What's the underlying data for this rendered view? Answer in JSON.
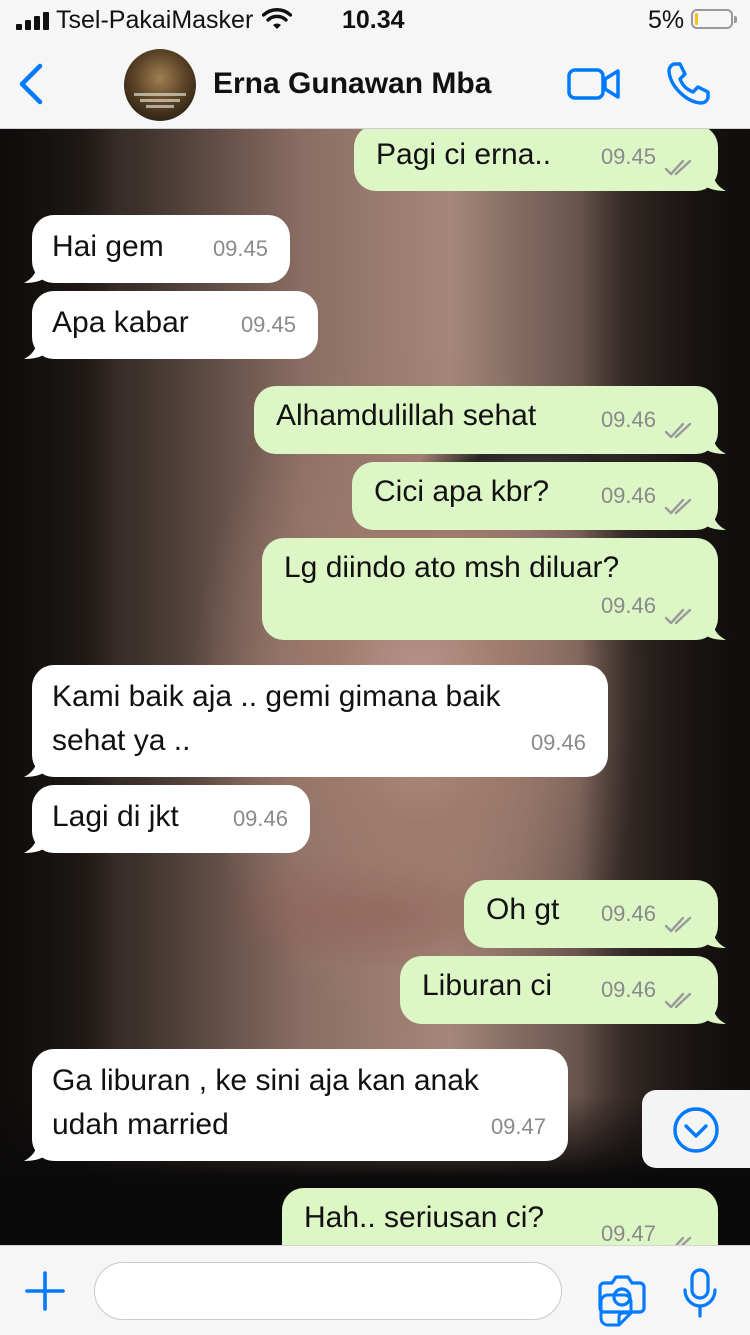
{
  "status_bar": {
    "carrier": "Tsel-PakaiMasker",
    "time": "10.34",
    "battery": "5%"
  },
  "header": {
    "contact_name": "Erna Gunawan Mba"
  },
  "messages": [
    {
      "dir": "out",
      "lines": [
        "Pagi ci erna.."
      ],
      "time": "09.45"
    },
    {
      "dir": "in",
      "lines": [
        "Hai gem"
      ],
      "time": "09.45"
    },
    {
      "dir": "in",
      "lines": [
        "Apa kabar"
      ],
      "time": "09.45"
    },
    {
      "dir": "out",
      "lines": [
        "Alhamdulillah sehat"
      ],
      "time": "09.46"
    },
    {
      "dir": "out",
      "lines": [
        "Cici apa kbr?"
      ],
      "time": "09.46"
    },
    {
      "dir": "out",
      "lines": [
        "Lg diindo ato msh diluar?"
      ],
      "time": "09.46"
    },
    {
      "dir": "in",
      "lines": [
        "Kami baik aja .. gemi gimana baik",
        "sehat ya .."
      ],
      "time": "09.46"
    },
    {
      "dir": "in",
      "lines": [
        "Lagi di jkt"
      ],
      "time": "09.46"
    },
    {
      "dir": "out",
      "lines": [
        "Oh gt"
      ],
      "time": "09.46"
    },
    {
      "dir": "out",
      "lines": [
        "Liburan ci"
      ],
      "time": "09.46"
    },
    {
      "dir": "in",
      "lines": [
        "Ga liburan , ke sini aja kan anak",
        "udah married"
      ],
      "time": "09.47"
    },
    {
      "dir": "out",
      "lines": [
        "Hah.. seriusan ci?"
      ],
      "time": "09.47"
    }
  ],
  "composer": {
    "placeholder": ""
  },
  "colors": {
    "accent": "#007aff",
    "outgoing_bubble": "#ddf6c5",
    "incoming_bubble": "#ffffff",
    "read_tick": "#9a9a9a"
  },
  "icons": [
    "back-chevron-icon",
    "video-call-icon",
    "phone-call-icon",
    "scroll-down-icon",
    "plus-icon",
    "sticker-icon",
    "camera-icon",
    "microphone-icon"
  ]
}
